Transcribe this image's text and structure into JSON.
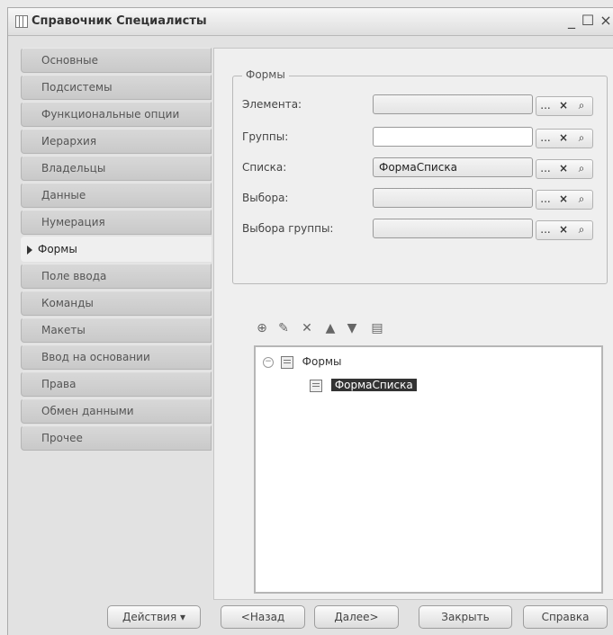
{
  "window": {
    "title": "Справочник Специалисты",
    "min_glyph": "_",
    "max_glyph": "☐",
    "close_glyph": "×"
  },
  "nav": {
    "items": [
      {
        "label": "Основные"
      },
      {
        "label": "Подсистемы"
      },
      {
        "label": "Функциональные опции"
      },
      {
        "label": "Иерархия"
      },
      {
        "label": "Владельцы"
      },
      {
        "label": "Данные"
      },
      {
        "label": "Нумерация"
      },
      {
        "label": "Формы",
        "active": true
      },
      {
        "label": "Поле ввода"
      },
      {
        "label": "Команды"
      },
      {
        "label": "Макеты"
      },
      {
        "label": "Ввод на основании"
      },
      {
        "label": "Права"
      },
      {
        "label": "Обмен данными"
      },
      {
        "label": "Прочее"
      }
    ]
  },
  "forms_group": {
    "legend": "Формы",
    "fields": [
      {
        "label": "Элемента:",
        "value": "",
        "disabled": true
      },
      {
        "label": "Группы:",
        "value": "",
        "disabled": false
      },
      {
        "label": "Списка:",
        "value": "ФормаСписка",
        "disabled": true
      },
      {
        "label": "Выбора:",
        "value": "",
        "disabled": true
      },
      {
        "label": "Выбора группы:",
        "value": "",
        "disabled": true
      }
    ],
    "field_buttons": {
      "dots": "...",
      "clear": "×",
      "search": "⌕"
    }
  },
  "toolbar": {
    "icons": [
      "add-icon",
      "edit-icon",
      "delete-icon",
      "move-up-icon",
      "move-down-icon",
      "open-icon"
    ]
  },
  "tree": {
    "root_label": "Формы",
    "child_label": "ФормаСписка"
  },
  "buttons": {
    "actions": "Действия",
    "back": "<Назад",
    "next": "Далее>",
    "close": "Закрыть",
    "help": "Справка"
  }
}
